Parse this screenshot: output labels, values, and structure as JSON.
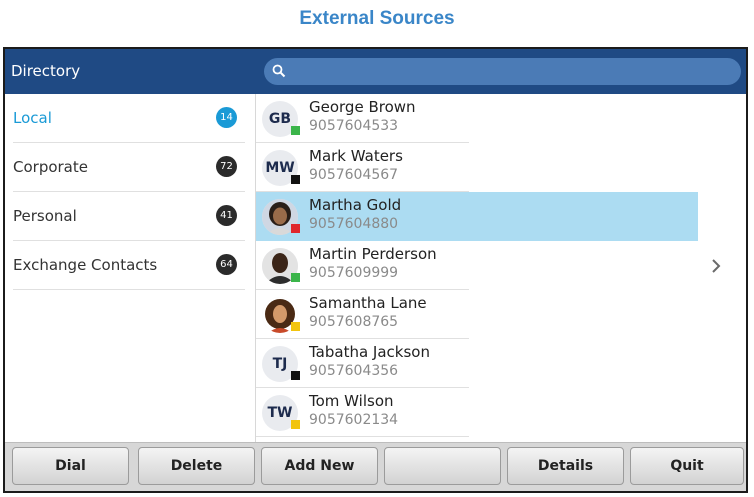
{
  "page_heading": "External Sources",
  "header": {
    "title": "Directory"
  },
  "search": {
    "placeholder": "",
    "icon": "search-icon"
  },
  "sidebar": {
    "items": [
      {
        "label": "Local",
        "count": "14",
        "active": true
      },
      {
        "label": "Corporate",
        "count": "72",
        "active": false
      },
      {
        "label": "Personal",
        "count": "41",
        "active": false
      },
      {
        "label": "Exchange Contacts",
        "count": "64",
        "active": false
      }
    ]
  },
  "contacts": [
    {
      "name": "George Brown",
      "number": "9057604533",
      "initials": "GB",
      "presence": "available",
      "photo": false
    },
    {
      "name": "Mark Waters",
      "number": "9057604567",
      "initials": "MW",
      "presence": "offline",
      "photo": false
    },
    {
      "name": "Martha Gold",
      "number": "9057604880",
      "initials": "",
      "presence": "busy",
      "photo": true,
      "selected": true
    },
    {
      "name": "Martin Perderson",
      "number": "9057609999",
      "initials": "",
      "presence": "available",
      "photo": true
    },
    {
      "name": "Samantha Lane",
      "number": "9057608765",
      "initials": "",
      "presence": "away",
      "photo": true
    },
    {
      "name": "Tabatha Jackson",
      "number": "9057604356",
      "initials": "TJ",
      "presence": "offline",
      "photo": false
    },
    {
      "name": "Tom Wilson",
      "number": "9057602134",
      "initials": "TW",
      "presence": "away",
      "photo": false
    }
  ],
  "softkeys": [
    "Dial",
    "Delete",
    "Add New",
    "",
    "Details",
    "Quit"
  ],
  "colors": {
    "header": "#1f4a84",
    "accent": "#1a9ad6",
    "selected_row": "#acdcf2",
    "available": "#3bb54a",
    "busy": "#e0262b",
    "away": "#f2c40e",
    "offline": "#111111"
  }
}
